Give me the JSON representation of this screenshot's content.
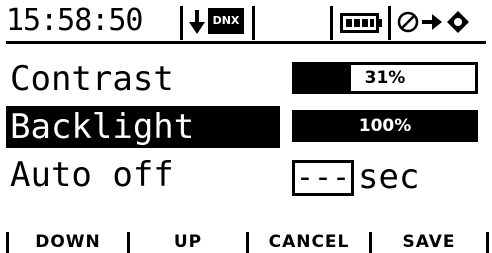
{
  "status_bar": {
    "time": "15:58:50",
    "receiver_label": "DNX",
    "icons": [
      "arrow-down-icon",
      "battery-icon",
      "timer-icon",
      "arrow-right-icon",
      "shield-icon"
    ]
  },
  "settings": [
    {
      "label": "Contrast",
      "display": "31%",
      "level": 0.31,
      "selected": false
    },
    {
      "label": "Backlight",
      "display": "100%",
      "level": 1.0,
      "selected": true
    },
    {
      "label": "Auto off",
      "value": "---",
      "unit": "sec",
      "selected": false
    }
  ],
  "softkeys": [
    "DOWN",
    "UP",
    "CANCEL",
    "SAVE"
  ],
  "colors": {
    "foreground": "#000000",
    "background": "#ffffff"
  }
}
